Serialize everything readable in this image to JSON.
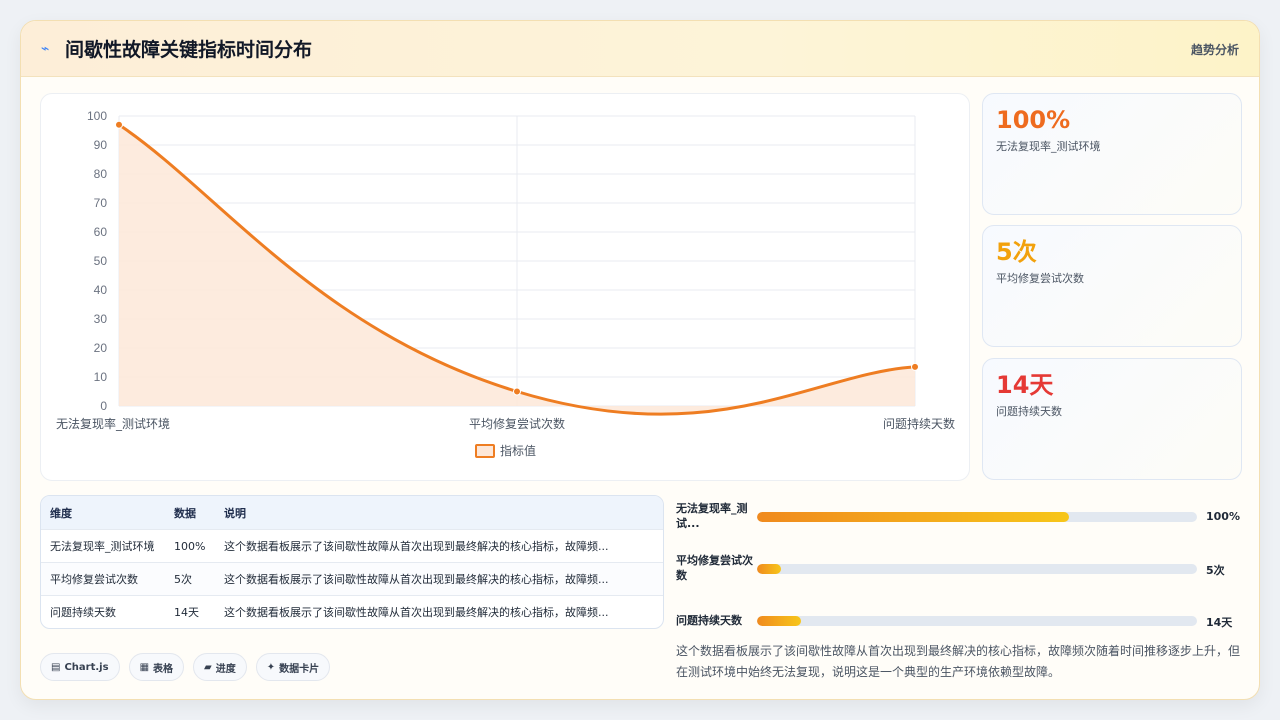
{
  "header": {
    "icon": "lightning-icon",
    "title": "间歇性故障关键指标时间分布",
    "action": "趋势分析"
  },
  "colors": {
    "accent": "#ee7d22",
    "area": "#fde7d8",
    "kpi1": "#ee6b1f",
    "kpi2": "#f2a10c",
    "kpi3": "#e53935"
  },
  "chart_data": {
    "type": "area",
    "categories": [
      "无法复现率_测试环境",
      "平均修复尝试次数",
      "问题持续天数"
    ],
    "series": [
      {
        "name": "指标值",
        "values": [
          97,
          5,
          13.5
        ]
      }
    ],
    "ylim": [
      0,
      100
    ],
    "yticks": [
      "0",
      "10",
      "20",
      "30",
      "40",
      "50",
      "60",
      "70",
      "80",
      "90",
      "100"
    ],
    "grid": true,
    "legend": "bottom-center"
  },
  "kpis": [
    {
      "value": "100%",
      "label": "无法复现率_测试环境"
    },
    {
      "value": "5次",
      "label": "平均修复尝试次数"
    },
    {
      "value": "14天",
      "label": "问题持续天数"
    }
  ],
  "table": {
    "headers": [
      "维度",
      "数据",
      "说明"
    ],
    "rows": [
      {
        "dim": "无法复现率_测试环境",
        "val": "100%",
        "note": "这个数据看板展示了该间歇性故障从首次出现到最终解决的核心指标，故障频..."
      },
      {
        "dim": "平均修复尝试次数",
        "val": "5次",
        "note": "这个数据看板展示了该间歇性故障从首次出现到最终解决的核心指标，故障频..."
      },
      {
        "dim": "问题持续天数",
        "val": "14天",
        "note": "这个数据看板展示了该间歇性故障从首次出现到最终解决的核心指标，故障频..."
      }
    ]
  },
  "tags": [
    {
      "icon": "chart-icon",
      "glyph": "▤",
      "label": "Chart.js"
    },
    {
      "icon": "table-icon",
      "glyph": "▦",
      "label": "表格"
    },
    {
      "icon": "progress-icon",
      "glyph": "▰",
      "label": "进度"
    },
    {
      "icon": "sparkle-icon",
      "glyph": "✦",
      "label": "数据卡片"
    }
  ],
  "progress": [
    {
      "label": "无法复现率_测试...",
      "percent": 71,
      "value": "100%"
    },
    {
      "label": "平均修复尝试次数",
      "percent": 5.5,
      "value": "5次"
    },
    {
      "label": "问题持续天数",
      "percent": 10,
      "value": "14天"
    }
  ],
  "description": "这个数据看板展示了该间歇性故障从首次出现到最终解决的核心指标，故障频次随着时间推移逐步上升，但在测试环境中始终无法复现，说明这是一个典型的生产环境依赖型故障。"
}
